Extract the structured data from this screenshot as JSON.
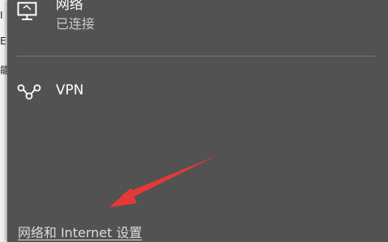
{
  "background_window": {
    "fragments": [
      "I",
      "E",
      "能"
    ]
  },
  "network": {
    "name": "网络",
    "status": "已连接",
    "icon": "monitor-network-icon"
  },
  "vpn": {
    "label": "VPN",
    "icon": "vpn-icon"
  },
  "footer": {
    "settings_link": "网络和 Internet 设置"
  },
  "annotation": {
    "arrow_color": "#e53935"
  },
  "colors": {
    "panel": "#525252",
    "text": "#ffffff",
    "muted_text": "#c8c8c8",
    "divider": "#7a7a7a"
  }
}
